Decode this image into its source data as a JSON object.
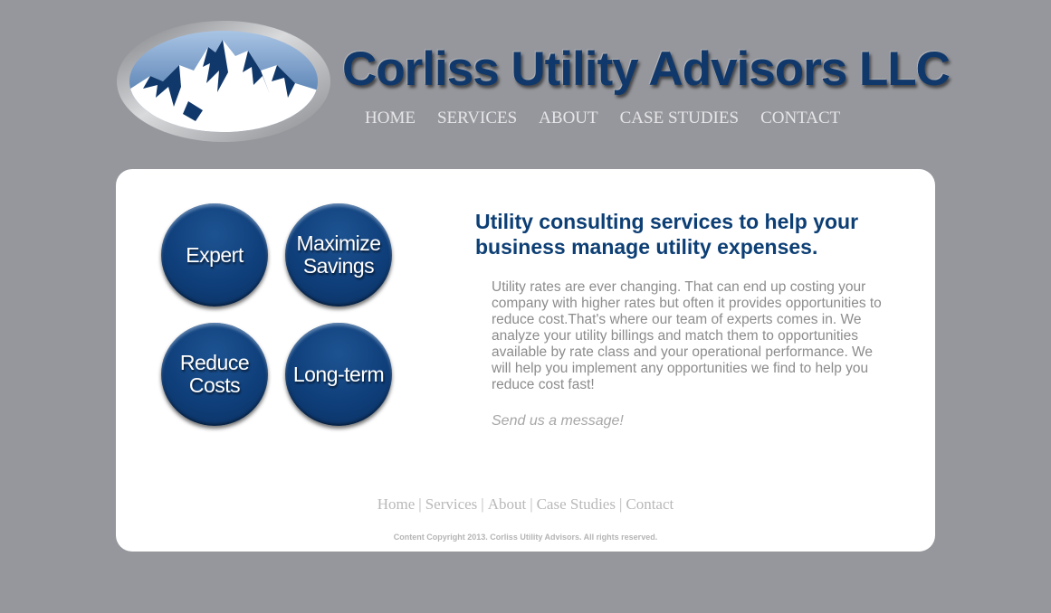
{
  "header": {
    "title": "Corliss Utility Advisors LLC",
    "nav": [
      "HOME",
      "SERVICES",
      "ABOUT",
      "CASE STUDIES",
      "CONTACT"
    ]
  },
  "features": [
    "Expert",
    "Maximize\nSavings",
    "Reduce\nCosts",
    "Long-term"
  ],
  "main": {
    "headline": "Utility consulting services to help your business manage utility expenses.",
    "body": "Utility rates are ever changing. That can end up costing your company with higher rates but often it provides opportunities to reduce cost.That's where our team of experts comes in. We analyze your utility billings and match them to opportunities available by rate class and your operational performance. We will help you implement any opportunities we find to help you reduce cost fast!",
    "cta": "Send us a message!"
  },
  "footer": {
    "links": [
      "Home",
      "Services",
      "About",
      "Case Studies",
      "Contact"
    ],
    "separator": "|",
    "copyright": "Content Copyright 2013. Corliss Utility Advisors. All rights reserved."
  },
  "colors": {
    "background": "#96979c",
    "brand_blue": "#10386a",
    "panel": "#ffffff"
  }
}
